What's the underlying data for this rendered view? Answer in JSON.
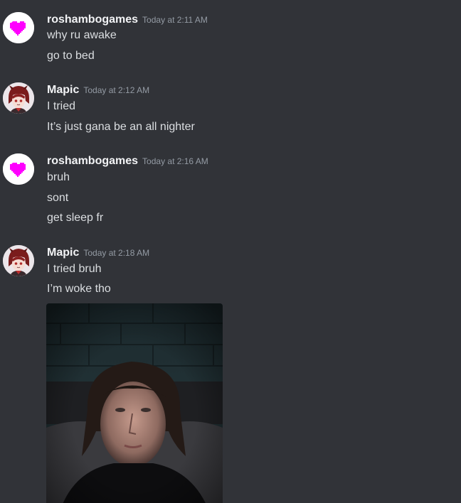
{
  "messages": [
    {
      "author": "roshambogames",
      "timestamp": "Today at 2:11 AM",
      "avatar": "pink-heart-icon",
      "lines": [
        "why ru awake",
        "go to bed"
      ]
    },
    {
      "author": "Mapic",
      "timestamp": "Today at 2:12 AM",
      "avatar": "anime-character-avatar",
      "lines": [
        "I tried",
        "It’s just gana be an all nighter"
      ]
    },
    {
      "author": "roshambogames",
      "timestamp": "Today at 2:16 AM",
      "avatar": "pink-heart-icon",
      "lines": [
        "bruh",
        "sont",
        "get sleep fr"
      ]
    },
    {
      "author": "Mapic",
      "timestamp": "Today at 2:18 AM",
      "avatar": "anime-character-avatar",
      "lines": [
        "I tried bruh",
        "I’m woke tho"
      ],
      "attachment": "photo-attachment"
    }
  ],
  "colors": {
    "background": "#313338",
    "username": "#f2f3f5",
    "timestamp": "#949ba4",
    "message_text": "#dbdee1",
    "heart": "#ff00ff"
  }
}
